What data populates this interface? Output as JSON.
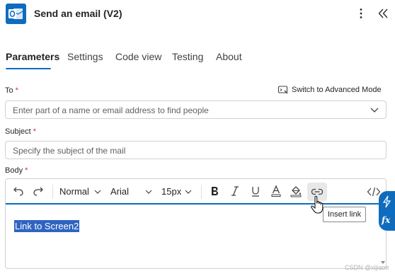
{
  "header": {
    "title": "Send an email (V2)",
    "icon": "outlook-icon",
    "menu_icon": "more-vertical-icon",
    "collapse_icon": "double-chevron-left-icon"
  },
  "tabs": [
    {
      "label": "Parameters",
      "active": true
    },
    {
      "label": "Settings",
      "active": false
    },
    {
      "label": "Code view",
      "active": false
    },
    {
      "label": "Testing",
      "active": false
    },
    {
      "label": "About",
      "active": false
    }
  ],
  "to": {
    "label": "To",
    "required_mark": "*",
    "placeholder": "Enter part of a name or email address to find people",
    "advanced_mode_label": "Switch to Advanced Mode"
  },
  "subject": {
    "label": "Subject",
    "required_mark": "*",
    "placeholder": "Specify the subject of the mail"
  },
  "body": {
    "label": "Body",
    "required_mark": "*",
    "toolbar": {
      "paragraph_style": "Normal",
      "font_family": "Arial",
      "font_size": "15px"
    },
    "content_selected": "Link to Screen2",
    "tooltip": "Insert link"
  },
  "side_actions": [
    "lightning-icon",
    "fx-icon"
  ],
  "watermark": "CSDN @xijiaoe",
  "colors": {
    "accent": "#0f6cbd",
    "selection": "#2f64c0",
    "required": "#c4314b"
  }
}
